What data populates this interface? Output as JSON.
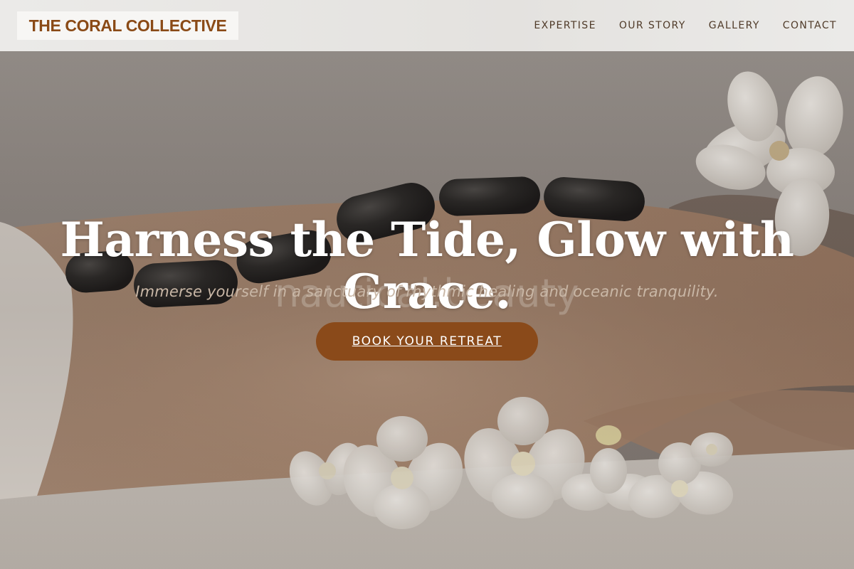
{
  "header": {
    "logo_text": "THE CORAL COLLECTIVE",
    "nav": [
      {
        "label": "EXPERTISE"
      },
      {
        "label": "OUR STORY"
      },
      {
        "label": "GALLERY"
      },
      {
        "label": "CONTACT"
      }
    ]
  },
  "hero": {
    "title": "Harness the Tide, Glow with Grace.",
    "subtitle": "Immerse yourself in a sanctuary of rhythmic healing and oceanic tranquility.",
    "watermark": "nautical.beauty",
    "cta_label": "BOOK YOUR RETREAT",
    "background_image": "hot-stone-massage-photo"
  },
  "colors": {
    "brand": "#8a4a16",
    "cta_background": "#8a4a1a",
    "nav_text": "#4f3a28",
    "header_background": "#e8e7e5"
  }
}
